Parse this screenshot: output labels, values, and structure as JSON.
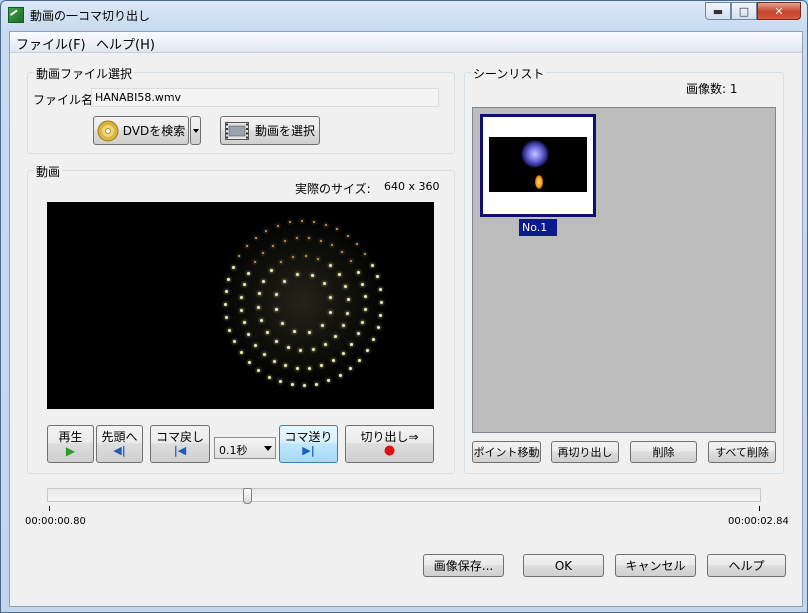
{
  "window": {
    "title": "動画の一コマ切り出し",
    "min_symbol": "▬",
    "max_symbol": "□",
    "close_symbol": "✕"
  },
  "menu": [
    "ファイル(F)",
    "ヘルプ(H)"
  ],
  "file_group": {
    "legend": "動画ファイル選択",
    "filename_label": "ファイル名:",
    "filename_value": "HANABI58.wmv",
    "dvd_button": "DVDを検索",
    "select_button": "動画を選択"
  },
  "video_group": {
    "legend": "動画",
    "size_label": "実際のサイズ:",
    "size_value": "640 x 360"
  },
  "controls": {
    "play": "再生",
    "to_start": "先頭へ",
    "step_back": "コマ戻し",
    "step_interval": "0.1秒",
    "step_forward": "コマ送り",
    "cut": "切り出し⇒",
    "play_glyph": "▶",
    "to_start_glyph": "◀|",
    "step_back_glyph": "|◀",
    "step_forward_glyph": "▶|",
    "cut_glyph": "●"
  },
  "scene_group": {
    "legend": "シーンリスト",
    "count_label": "画像数: 1",
    "items": [
      {
        "label": "No.1"
      }
    ],
    "move_point": "ポイント移動",
    "recut": "再切り出し",
    "delete": "削除",
    "delete_all": "すべて削除"
  },
  "timeline": {
    "start_time": "00:00:00.80",
    "end_time": "00:00:02.84",
    "position_fraction": 0.28
  },
  "footer": {
    "save_image": "画像保存...",
    "ok": "OK",
    "cancel": "キャンセル",
    "help": "ヘルプ"
  },
  "colors": {
    "play_glyph": "#2f9b2f",
    "nav_glyph": "#1a5fb4",
    "cut_glyph": "#e11111",
    "selection": "#0b1a8a"
  }
}
